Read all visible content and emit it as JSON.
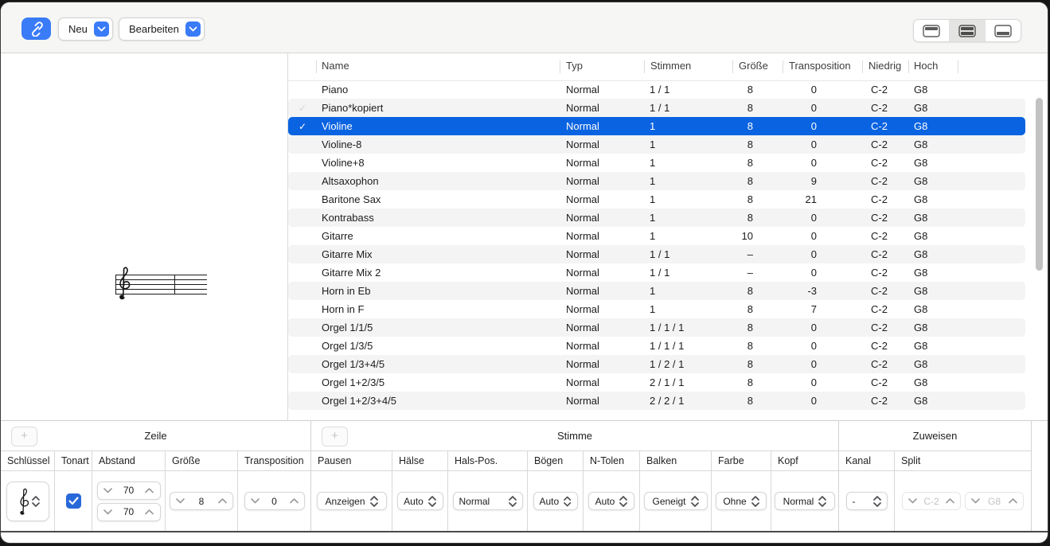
{
  "toolbar": {
    "link_button": "link",
    "new_button": "Neu",
    "edit_button": "Bearbeiten",
    "view_segments": [
      {
        "name": "pane-top",
        "selected": false
      },
      {
        "name": "pane-split",
        "selected": true
      },
      {
        "name": "pane-bottom",
        "selected": false
      }
    ]
  },
  "colors": {
    "accent_blue": "#3a7bf7",
    "selection_blue": "#0a63e1",
    "checkbox_blue": "#2968d9"
  },
  "staff_table": {
    "columns": [
      "Name",
      "Typ",
      "Stimmen",
      "Größe",
      "Transposition",
      "Niedrig",
      "Hoch"
    ],
    "rows": [
      {
        "check": "",
        "name": "Piano",
        "typ": "Normal",
        "stimmen": "1 / 1",
        "groesse": "8",
        "transposition": "0",
        "niedrig": "C-2",
        "hoch": "G8",
        "state": ""
      },
      {
        "check": "✓",
        "name": "Piano*kopiert",
        "typ": "Normal",
        "stimmen": "1 / 1",
        "groesse": "8",
        "transposition": "0",
        "niedrig": "C-2",
        "hoch": "G8",
        "state": "muted"
      },
      {
        "check": "✓",
        "name": "Violine",
        "typ": "Normal",
        "stimmen": "1",
        "groesse": "8",
        "transposition": "0",
        "niedrig": "C-2",
        "hoch": "G8",
        "state": "selected"
      },
      {
        "check": "",
        "name": "Violine-8",
        "typ": "Normal",
        "stimmen": "1",
        "groesse": "8",
        "transposition": "0",
        "niedrig": "C-2",
        "hoch": "G8",
        "state": ""
      },
      {
        "check": "",
        "name": "Violine+8",
        "typ": "Normal",
        "stimmen": "1",
        "groesse": "8",
        "transposition": "0",
        "niedrig": "C-2",
        "hoch": "G8",
        "state": ""
      },
      {
        "check": "",
        "name": "Altsaxophon",
        "typ": "Normal",
        "stimmen": "1",
        "groesse": "8",
        "transposition": "9",
        "niedrig": "C-2",
        "hoch": "G8",
        "state": ""
      },
      {
        "check": "",
        "name": "Baritone Sax",
        "typ": "Normal",
        "stimmen": "1",
        "groesse": "8",
        "transposition": "21",
        "niedrig": "C-2",
        "hoch": "G8",
        "state": ""
      },
      {
        "check": "",
        "name": "Kontrabass",
        "typ": "Normal",
        "stimmen": "1",
        "groesse": "8",
        "transposition": "0",
        "niedrig": "C-2",
        "hoch": "G8",
        "state": ""
      },
      {
        "check": "",
        "name": "Gitarre",
        "typ": "Normal",
        "stimmen": "1",
        "groesse": "10",
        "transposition": "0",
        "niedrig": "C-2",
        "hoch": "G8",
        "state": ""
      },
      {
        "check": "",
        "name": "Gitarre Mix",
        "typ": "Normal",
        "stimmen": "1 / 1",
        "groesse": "–",
        "transposition": "0",
        "niedrig": "C-2",
        "hoch": "G8",
        "state": ""
      },
      {
        "check": "",
        "name": "Gitarre Mix 2",
        "typ": "Normal",
        "stimmen": "1 / 1",
        "groesse": "–",
        "transposition": "0",
        "niedrig": "C-2",
        "hoch": "G8",
        "state": ""
      },
      {
        "check": "",
        "name": "Horn in Eb",
        "typ": "Normal",
        "stimmen": "1",
        "groesse": "8",
        "transposition": "-3",
        "niedrig": "C-2",
        "hoch": "G8",
        "state": ""
      },
      {
        "check": "",
        "name": "Horn in F",
        "typ": "Normal",
        "stimmen": "1",
        "groesse": "8",
        "transposition": "7",
        "niedrig": "C-2",
        "hoch": "G8",
        "state": ""
      },
      {
        "check": "",
        "name": "Orgel 1/1/5",
        "typ": "Normal",
        "stimmen": "1 / 1 / 1",
        "groesse": "8",
        "transposition": "0",
        "niedrig": "C-2",
        "hoch": "G8",
        "state": ""
      },
      {
        "check": "",
        "name": "Orgel 1/3/5",
        "typ": "Normal",
        "stimmen": "1 / 1 / 1",
        "groesse": "8",
        "transposition": "0",
        "niedrig": "C-2",
        "hoch": "G8",
        "state": ""
      },
      {
        "check": "",
        "name": "Orgel 1/3+4/5",
        "typ": "Normal",
        "stimmen": "1 / 2 / 1",
        "groesse": "8",
        "transposition": "0",
        "niedrig": "C-2",
        "hoch": "G8",
        "state": ""
      },
      {
        "check": "",
        "name": "Orgel 1+2/3/5",
        "typ": "Normal",
        "stimmen": "2 / 1 / 1",
        "groesse": "8",
        "transposition": "0",
        "niedrig": "C-2",
        "hoch": "G8",
        "state": ""
      },
      {
        "check": "",
        "name": "Orgel 1+2/3+4/5",
        "typ": "Normal",
        "stimmen": "2 / 2 / 1",
        "groesse": "8",
        "transposition": "0",
        "niedrig": "C-2",
        "hoch": "G8",
        "state": ""
      }
    ]
  },
  "preview": {
    "clef": "treble-clef"
  },
  "inspector": {
    "zeile": {
      "title": "Zeile",
      "add_button": "+",
      "columns": [
        "Schlüssel",
        "Tonart",
        "Abstand",
        "Größe",
        "Transposition"
      ],
      "values": {
        "schluessel": "treble-clef",
        "tonart_checked": true,
        "abstand_top": "70",
        "abstand_bottom": "70",
        "groesse": "8",
        "transposition": "0"
      }
    },
    "stimme": {
      "title": "Stimme",
      "add_button": "+",
      "columns": [
        "Pausen",
        "Hälse",
        "Hals-Pos.",
        "Bögen",
        "N-Tolen",
        "Balken",
        "Farbe",
        "Kopf"
      ],
      "values": {
        "pausen": "Anzeigen",
        "haelse": "Auto",
        "hals_pos": "Normal",
        "boegen": "Auto",
        "n_tolen": "Auto",
        "balken": "Geneigt",
        "farbe": "Ohne",
        "kopf": "Normal"
      }
    },
    "zuweisen": {
      "title": "Zuweisen",
      "columns": [
        "Kanal",
        "Split"
      ],
      "values": {
        "kanal": "-",
        "split_low": "C-2",
        "split_high": "G8"
      }
    }
  }
}
